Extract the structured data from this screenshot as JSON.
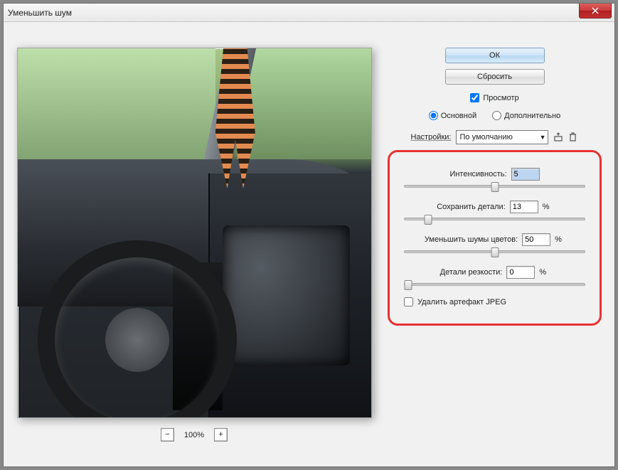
{
  "window": {
    "title": "Уменьшить шум"
  },
  "buttons": {
    "ok": "ОК",
    "reset": "Сбросить"
  },
  "preview_checkbox": "Просмотр",
  "mode": {
    "basic": "Основной",
    "advanced": "Дополнительно",
    "selected": "basic"
  },
  "settings": {
    "label": "Настройки:",
    "preset": "По умолчанию"
  },
  "sliders": {
    "intensity": {
      "label": "Интенсивность:",
      "value": "5",
      "show_pct": false,
      "pos": 50
    },
    "preserve": {
      "label": "Сохранить детали:",
      "value": "13",
      "show_pct": true,
      "pos": 13
    },
    "color_noise": {
      "label": "Уменьшить шумы цветов:",
      "value": "50",
      "show_pct": true,
      "pos": 50
    },
    "sharpen": {
      "label": "Детали резкости:",
      "value": "0",
      "show_pct": true,
      "pos": 0
    }
  },
  "remove_jpeg": {
    "label": "Удалить артефакт JPEG",
    "checked": false
  },
  "zoom": {
    "level": "100%"
  },
  "chart_data": null
}
